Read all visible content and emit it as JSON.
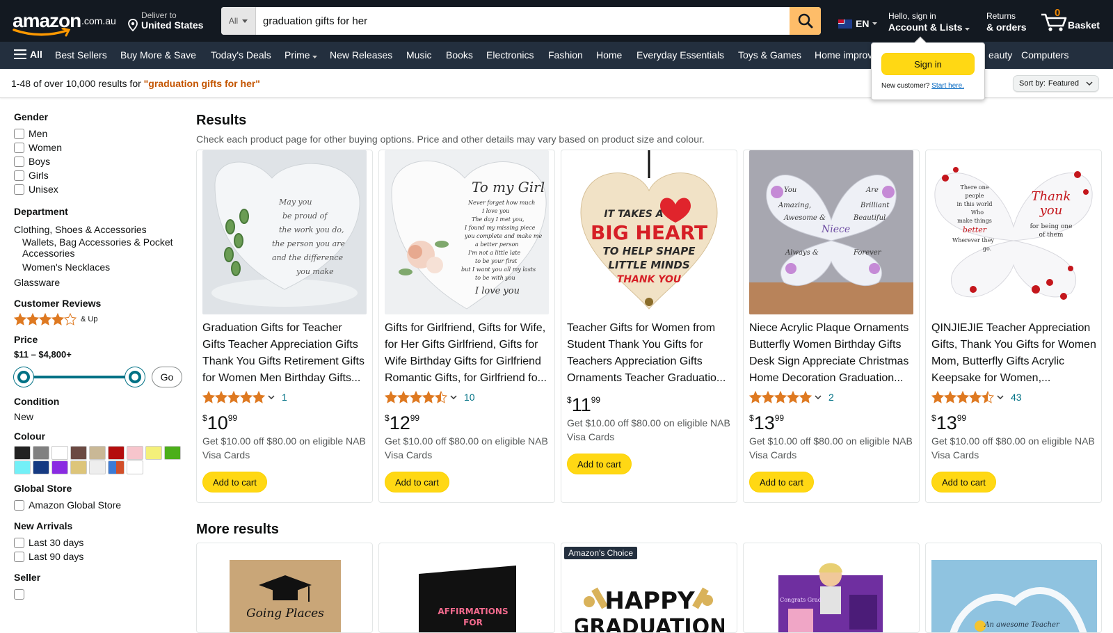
{
  "header": {
    "logo_word": "amazon",
    "logo_tld": ".com.au",
    "deliver_line1": "Deliver to",
    "deliver_line2": "United States",
    "search_category": "All",
    "search_value": "graduation gifts for her",
    "language": "EN",
    "account_line1": "Hello, sign in",
    "account_line2": "Account & Lists",
    "returns_line1": "Returns",
    "returns_line2": "& orders",
    "basket_count": "0",
    "basket_label": "Basket"
  },
  "nav": {
    "all_label": "All",
    "items": [
      "Best Sellers",
      "Buy More & Save",
      "Today's Deals",
      "Prime",
      "New Releases",
      "Music",
      "Books",
      "Electronics",
      "Fashion",
      "Home",
      "Everyday Essentials",
      "Toys & Games",
      "Home improv",
      "eauty",
      "Computers"
    ]
  },
  "results_bar": {
    "prefix": "1-48 of over 10,000 results for ",
    "query": "\"graduation gifts for her\"",
    "sort_label": "Sort by:",
    "sort_value": "Featured"
  },
  "signin_popup": {
    "button": "Sign in",
    "new_customer": "New customer?",
    "start_here": "Start here."
  },
  "sidebar": {
    "gender_title": "Gender",
    "gender": [
      "Men",
      "Women",
      "Boys",
      "Girls",
      "Unisex"
    ],
    "department_title": "Department",
    "departments": [
      "Clothing, Shoes & Accessories",
      "Wallets, Bag Accessories & Pocket Accessories",
      "Women's Necklaces",
      "Glassware"
    ],
    "reviews_title": "Customer Reviews",
    "reviews_up": "& Up",
    "reviews_stars": 4,
    "price_title": "Price",
    "price_range": "$11 – $4,800+",
    "price_go": "Go",
    "condition_title": "Condition",
    "condition_value": "New",
    "colour_title": "Colour",
    "colours": [
      "#222222",
      "#808080",
      "#ffffff",
      "#6b4a43",
      "#c9b896",
      "#b40d0d",
      "#f7c5cc",
      "#f4f07a",
      "#4caf1a",
      "#73f0f7",
      "#163a82",
      "#8a2be2",
      "#ddc57a",
      "#eeeeee",
      "multi",
      "#ffffff"
    ],
    "global_title": "Global Store",
    "global_item": "Amazon Global Store",
    "arrivals_title": "New Arrivals",
    "arrivals": [
      "Last 30 days",
      "Last 90 days"
    ],
    "seller_title": "Seller"
  },
  "results": {
    "heading": "Results",
    "subheading": "Check each product page for other buying options. Price and other details may vary based on product size and colour.",
    "products": [
      {
        "title": "Graduation Gifts for Teacher Gifts Teacher Appreciation Gifts Thank You Gifts Retirement Gifts for Women Men Birthday Gifts...",
        "rating": 5.0,
        "count": "1",
        "currency": "$",
        "whole": "10",
        "fraction": "99",
        "promo": "Get $10.00 off $80.00 on eligible NAB Visa Cards",
        "cart": "Add to cart"
      },
      {
        "title": "Gifts for Girlfriend, Gifts for Wife, for Her Gifts Girlfriend, Gifts for Wife Birthday Gifts for Girlfriend Romantic Gifts, for Girlfriend fo...",
        "rating": 4.5,
        "count": "10",
        "currency": "$",
        "whole": "12",
        "fraction": "99",
        "promo": "Get $10.00 off $80.00 on eligible NAB Visa Cards",
        "cart": "Add to cart"
      },
      {
        "title": "Teacher Gifts for Women from Student Thank You Gifts for Teachers Appreciation Gifts Ornaments Teacher Graduatio...",
        "rating": null,
        "count": "",
        "currency": "$",
        "whole": "11",
        "fraction": "99",
        "promo": "Get $10.00 off $80.00 on eligible NAB Visa Cards",
        "cart": "Add to cart"
      },
      {
        "title": "Niece Acrylic Plaque Ornaments Butterfly Women Birthday Gifts Desk Sign Appreciate Christmas Home Decoration Graduation...",
        "rating": 5.0,
        "count": "2",
        "currency": "$",
        "whole": "13",
        "fraction": "99",
        "promo": "Get $10.00 off $80.00 on eligible NAB Visa Cards",
        "cart": "Add to cart"
      },
      {
        "title": "QINJIEJIE Teacher Appreciation Gifts, Thank You Gifts for Women Mom, Butterfly Gifts Acrylic Keepsake for Women,...",
        "rating": 4.5,
        "count": "43",
        "currency": "$",
        "whole": "13",
        "fraction": "99",
        "promo": "Get $10.00 off $80.00 on eligible NAB Visa Cards",
        "cart": "Add to cart"
      }
    ],
    "images": {
      "p1": {
        "lines": [
          "May you",
          "be proud of",
          "the work you do,",
          "the person you are",
          "and the difference",
          "you make"
        ]
      },
      "p2": {
        "lines": [
          "To my Girl",
          "Never forget how much",
          "I love you",
          "The day I met you,",
          "I found my missing piece",
          "you complete and make me",
          "a better person",
          "I'm not a little late",
          "to be your first",
          "but I want you all my lasts",
          "to be with you",
          "I love you"
        ]
      },
      "p3": {
        "lines": [
          "IT TAKES A",
          "BIG HEART",
          "TO HELP SHAPE",
          "LITTLE MINDS",
          "THANK YOU"
        ]
      },
      "p4": {
        "lines": [
          "You",
          "Are",
          "Amazing,",
          "Brilliant",
          "Awesome &",
          "Beautiful",
          "Niece",
          "Always &",
          "Forever"
        ]
      },
      "p5": {
        "lines": [
          "There one",
          "people",
          "in this world",
          "Who",
          "make things",
          "better",
          "Wherever they",
          "go.",
          "Thank",
          "you",
          "for being one",
          "of them"
        ]
      }
    }
  },
  "more_results": {
    "heading": "More results",
    "badge": "Amazon's Choice",
    "image_texts": [
      "Going Places",
      "AFFIRMATIONS",
      "FOR",
      "HAPPY",
      "GRADUATION",
      "Congrats Grad",
      "An awesome Teacher"
    ]
  }
}
